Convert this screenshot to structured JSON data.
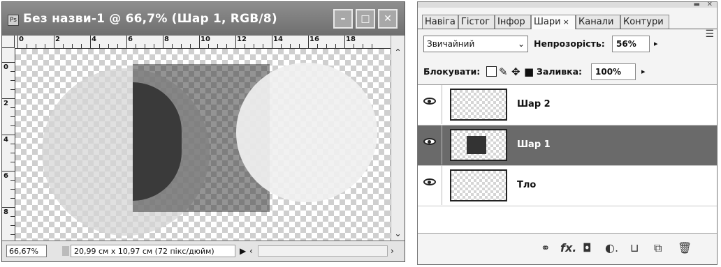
{
  "document": {
    "title": "Без назви-1 @ 66,7% (Шар 1, RGB/8)",
    "app_icon": "Ps",
    "window_buttons": [
      "minimize-icon",
      "maximize-icon",
      "close-icon"
    ],
    "ruler_h_labels": [
      "0",
      "2",
      "4",
      "6",
      "8",
      "10",
      "12",
      "14",
      "16",
      "18"
    ],
    "ruler_v_labels": [
      "0",
      "2",
      "4",
      "6",
      "8"
    ],
    "zoom_value": "66,67%",
    "status_info": "20,99 см x 10,97 см (72 пікс/дюйм)"
  },
  "panel": {
    "tabs": [
      "Навіга",
      "Гістог",
      "Інфор",
      "Шари",
      "Канали",
      "Контури"
    ],
    "active_tab": "Шари",
    "blend_mode": "Звичайний",
    "opacity_label": "Непрозорість:",
    "opacity_value": "56%",
    "lock_label": "Блокувати:",
    "fill_label": "Заливка:",
    "fill_value": "100%",
    "layers": [
      {
        "name": "Шар 2",
        "selected": false,
        "visible": true
      },
      {
        "name": "Шар 1",
        "selected": true,
        "visible": true
      },
      {
        "name": "Тло",
        "selected": false,
        "visible": true
      }
    ],
    "footer_icons": [
      "link-icon",
      "fx-icon",
      "mask-icon",
      "adjustment-icon",
      "group-folder-icon",
      "new-layer-icon",
      "trash-icon"
    ]
  },
  "colors": {
    "selected_layer_bg": "#6a6a6a",
    "titlebar": "#7a7a7a"
  }
}
